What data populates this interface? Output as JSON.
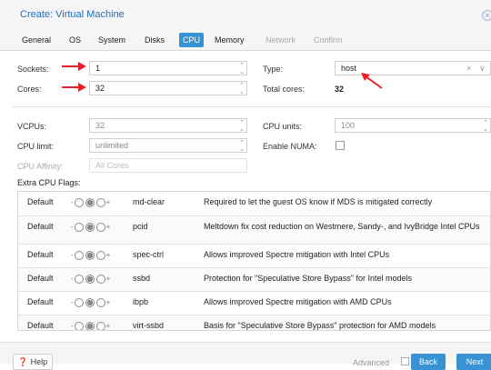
{
  "dialog": {
    "title": "Create: Virtual Machine"
  },
  "tabs": [
    {
      "label": "General"
    },
    {
      "label": "OS"
    },
    {
      "label": "System"
    },
    {
      "label": "Disks"
    },
    {
      "label": "CPU"
    },
    {
      "label": "Memory"
    },
    {
      "label": "Network"
    },
    {
      "label": "Confirm"
    }
  ],
  "cpu": {
    "sockets_label": "Sockets:",
    "sockets_value": "1",
    "cores_label": "Cores:",
    "cores_value": "32",
    "type_label": "Type:",
    "type_value": "host",
    "type_clear": "×",
    "type_caret": "∨",
    "total_cores_label": "Total cores:",
    "total_cores_value": "32",
    "vcpus_label": "VCPUs:",
    "vcpus_value": "32",
    "cpu_units_label": "CPU units:",
    "cpu_units_value": "100",
    "cpu_limit_label": "CPU limit:",
    "cpu_limit_value": "unlimited",
    "numa_label": "Enable NUMA:",
    "affinity_label": "CPU Affinity:",
    "affinity_value": "All Cores"
  },
  "flags": {
    "section_title": "Extra CPU Flags:",
    "minus": "-",
    "plus": "+",
    "rows": [
      {
        "state": "Default",
        "name": "md-clear",
        "desc": "Required to let the guest OS know if MDS is mitigated correctly"
      },
      {
        "state": "Default",
        "name": "pcid",
        "desc": "Meltdown fix cost reduction on Westmere, Sandy-, and IvyBridge Intel CPUs"
      },
      {
        "state": "Default",
        "name": "spec-ctrl",
        "desc": "Allows improved Spectre mitigation with Intel CPUs"
      },
      {
        "state": "Default",
        "name": "ssbd",
        "desc": "Protection for \"Speculative Store Bypass\" for Intel models"
      },
      {
        "state": "Default",
        "name": "ibpb",
        "desc": "Allows improved Spectre mitigation with AMD CPUs"
      },
      {
        "state": "Default",
        "name": "virt-ssbd",
        "desc": "Basis for \"Speculative Store Bypass\" protection for AMD models"
      }
    ]
  },
  "footer": {
    "help_label": "Help",
    "advanced_label": "Advanced",
    "back_label": "Back",
    "next_label": "Next"
  },
  "colors": {
    "accent": "#3892d4",
    "title": "#1f6cbf",
    "annotation_arrow": "#e8202a"
  },
  "icons": {
    "close": "close-icon",
    "help": "help-icon",
    "annotation": "red-arrow"
  }
}
